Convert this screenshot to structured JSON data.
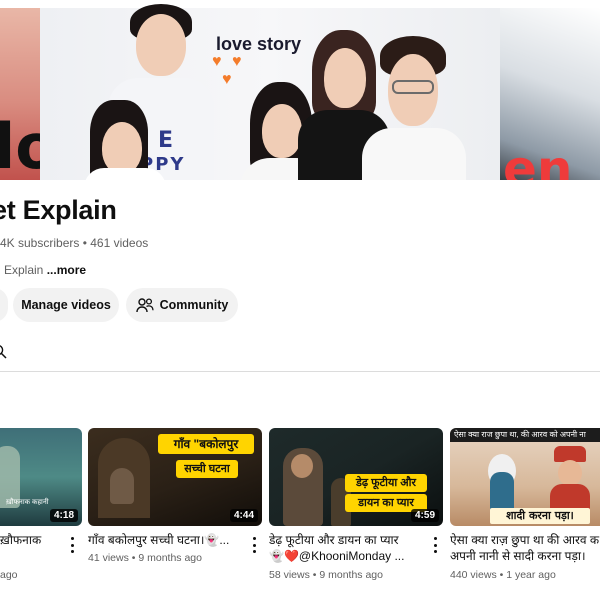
{
  "banner": {
    "left_text": "lo",
    "center_text": "love story",
    "right_text": "en"
  },
  "channel": {
    "name": "et Explain",
    "meta": "4K subscribers • 461 videos",
    "description": "Explain",
    "more_label": "...more"
  },
  "actions": {
    "manage_videos": "Manage videos",
    "community": "Community"
  },
  "videos": [
    {
      "title": "ख़ौफनाक",
      "views": "ago",
      "duration": "4:18",
      "thumb_text": "ख़ौफनाक कहानी"
    },
    {
      "title": "गाँव बकोलपुर सच्ची घटना।👻...",
      "views": "41 views • 9 months ago",
      "duration": "4:44",
      "thumb_line1": "गाँव \"बकोलपुर",
      "thumb_line2": "सच्ची घटना"
    },
    {
      "title": "डेढ़ फूटीया और डायन का प्यार",
      "title2": "👻❤️@KhooniMonday ...",
      "views": "58 views • 9 months ago",
      "duration": "4:59",
      "thumb_line1": "डेढ़ फूटीया और",
      "thumb_line2": "डायन का प्यार"
    },
    {
      "title": "ऐसा क्या राज़ छुपा था की आरव क",
      "title2": "अपनी नानी से सादी करना पड़ा।",
      "views": "440 views • 1 year ago",
      "thumb_top": "ऐसा क्या राज छुपा था, की आरव को अपनी ना",
      "thumb_bottom": "शादी करना पड़ा।"
    }
  ],
  "colors": {
    "accent_red": "#ef3b3b",
    "heart_orange": "#f47c2b",
    "pill_bg": "#f2f2f2",
    "thumb_yellow": "#ffd400"
  }
}
